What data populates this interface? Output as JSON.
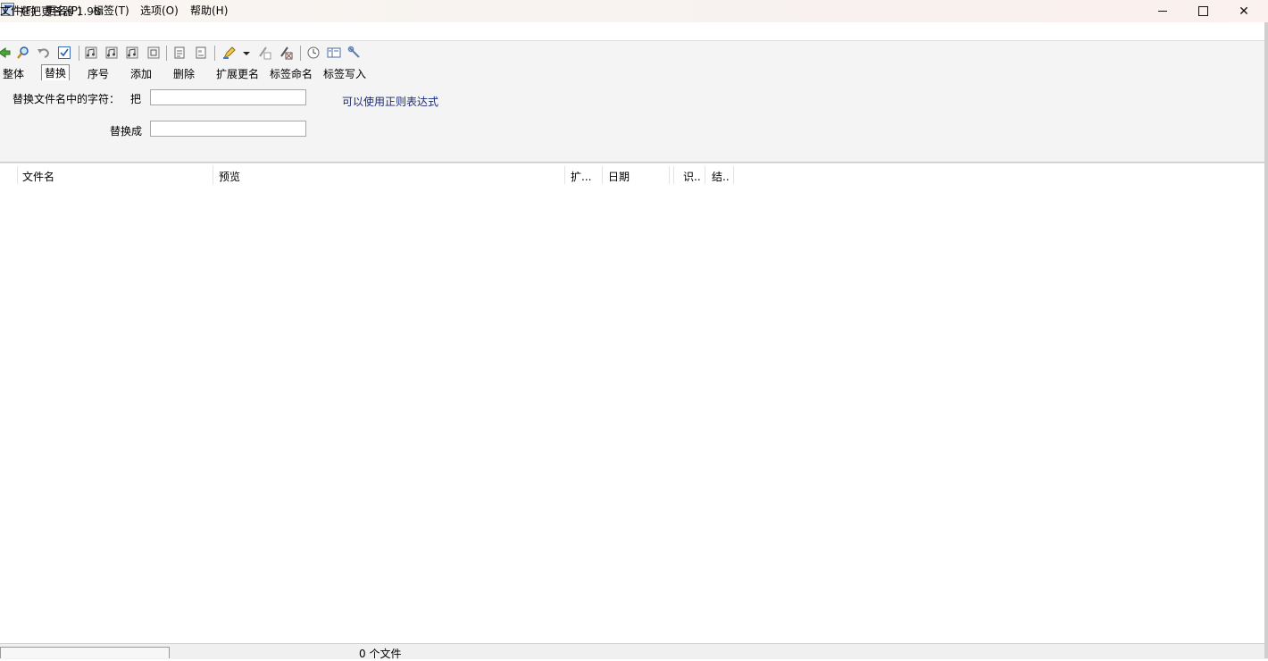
{
  "window": {
    "title": "拖把更名器 1.98i"
  },
  "menu": [
    {
      "label": "文件(F)"
    },
    {
      "label": "更名(P)"
    },
    {
      "label": "标签(T)"
    },
    {
      "label": "选项(O)"
    },
    {
      "label": "帮助(H)"
    }
  ],
  "toolbar": {
    "icons": [
      "add-files-icon",
      "search-icon",
      "undo-icon",
      "check-icon",
      "music-tag-1-icon",
      "music-tag-2-icon",
      "music-tag-3-icon",
      "music-tag-4-icon",
      "doc-icon",
      "doc-list-icon",
      "highlighter-icon",
      "dropdown-arrow-icon",
      "edit-icon",
      "erase-icon",
      "clock-icon",
      "view-icon",
      "tools-icon"
    ]
  },
  "tabs": [
    {
      "label": "整体"
    },
    {
      "label": "替换",
      "active": true
    },
    {
      "label": "序号"
    },
    {
      "label": "添加"
    },
    {
      "label": "删除"
    },
    {
      "label": "扩展更名"
    },
    {
      "label": "标签命名"
    },
    {
      "label": "标签写入"
    }
  ],
  "replace_panel": {
    "find_label": "替换文件名中的字符：",
    "find_prefix": "把",
    "find_value": "",
    "replace_label": "替换成",
    "replace_value": "",
    "regex_note": "可以使用正则表达式"
  },
  "columns": [
    {
      "label": "文件名"
    },
    {
      "label": "预览"
    },
    {
      "label": "扩..."
    },
    {
      "label": "日期"
    },
    {
      "label": "识.."
    },
    {
      "label": "结.."
    }
  ],
  "status": {
    "file_count": "0 个文件"
  },
  "colors": {
    "regex_note": "#1a2a7a",
    "panel_bg": "#f4f4f4"
  }
}
